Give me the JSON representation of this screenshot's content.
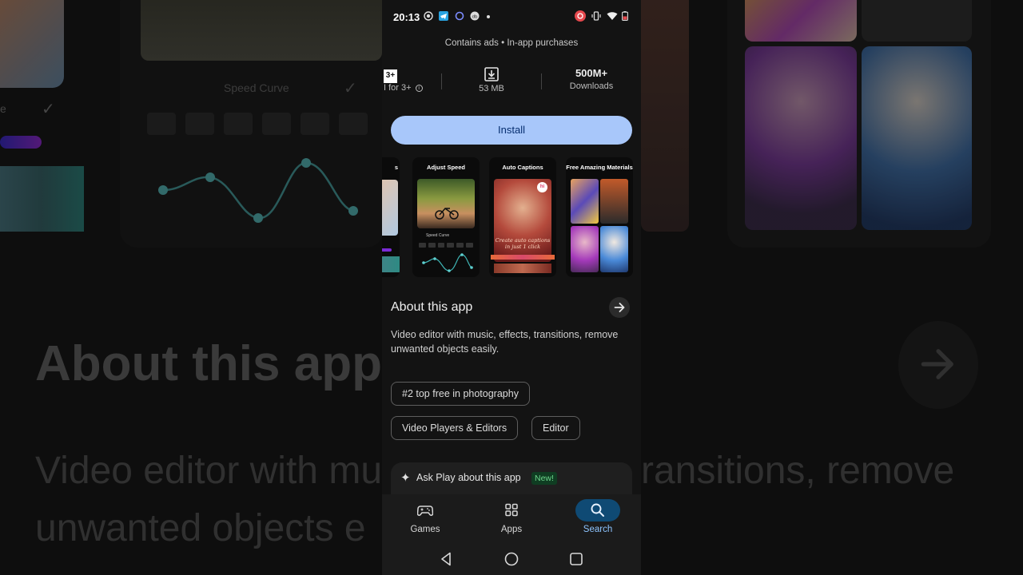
{
  "background": {
    "left_card": {
      "speed_label": "Speed Curve"
    },
    "big_about_title": "About this app",
    "big_text_line1": "Video editor with mu",
    "big_text_line1_right": "ransitions, remove",
    "big_text_line2": "unwanted objects e"
  },
  "status_bar": {
    "time": "20:13"
  },
  "app_meta": "Contains ads • In-app purchases",
  "stats": {
    "rating": {
      "badge": "3+",
      "label": "I for 3+"
    },
    "size": {
      "label": "53 MB"
    },
    "downloads": {
      "value": "500M+",
      "label": "Downloads"
    }
  },
  "install_label": "Install",
  "screenshots": [
    {
      "title": "s"
    },
    {
      "title": "Adjust Speed",
      "inner_label": "Speed Curve"
    },
    {
      "title": "Auto Captions",
      "caption": "Create auto captions in just 1 click"
    },
    {
      "title": "Free Amazing Materials"
    }
  ],
  "about": {
    "title": "About this app",
    "description": "Video editor with music, effects, transitions, remove unwanted objects easily."
  },
  "chips": [
    "#2 top free in photography",
    "Video Players & Editors",
    "Editor"
  ],
  "ask_play": {
    "text": "Ask Play about this app",
    "badge": "New!"
  },
  "bottom_nav": [
    {
      "label": "Games",
      "icon": "gamepad-icon",
      "active": false
    },
    {
      "label": "Apps",
      "icon": "apps-grid-icon",
      "active": false
    },
    {
      "label": "Search",
      "icon": "search-icon",
      "active": true
    }
  ],
  "colors": {
    "install_bg": "#a8c7fa",
    "install_text": "#062e6f",
    "active_nav_pill": "#0f4a74",
    "new_badge_bg": "#0f3d22",
    "new_badge_text": "#6dd58c"
  }
}
